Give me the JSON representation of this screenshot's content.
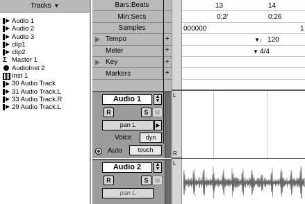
{
  "track_list": {
    "header": "Tracks",
    "items": [
      {
        "name": "Audio 1",
        "icon": "audio-track-icon"
      },
      {
        "name": "Audio 2",
        "icon": "audio-track-icon"
      },
      {
        "name": "Audio 3",
        "icon": "audio-track-icon"
      },
      {
        "name": "clip1",
        "icon": "audio-track-icon"
      },
      {
        "name": "clip2",
        "icon": "audio-track-icon"
      },
      {
        "name": "Master 1",
        "icon": "master-fader-icon"
      },
      {
        "name": "AudioInst  2",
        "icon": "aux-input-icon"
      },
      {
        "name": "Inst 1",
        "icon": "instrument-track-icon"
      },
      {
        "name": "30 Audio Track",
        "icon": "audio-track-icon"
      },
      {
        "name": "31 Audio Track.L",
        "icon": "audio-track-icon"
      },
      {
        "name": "33 Audio Track.R",
        "icon": "audio-track-icon"
      },
      {
        "name": "29 Audio Track.L",
        "icon": "audio-track-icon"
      }
    ]
  },
  "rulers": {
    "bars_beats": {
      "label": "Bars:Beats",
      "marks": [
        "13",
        "14"
      ]
    },
    "min_secs": {
      "label": "Min:Secs",
      "marks": [
        "0:2⁄",
        "0:26"
      ]
    },
    "samples": {
      "label": "Samples",
      "marks": [
        "000000",
        "1"
      ]
    },
    "tempo": {
      "label": "Tempo",
      "value": "120"
    },
    "meter": {
      "label": "Meter",
      "value": "4/4"
    },
    "key": {
      "label": "Key"
    },
    "markers": {
      "label": "Markers"
    }
  },
  "tracks": [
    {
      "name": "Audio 1",
      "rec": "R",
      "solo": "S",
      "mute": "M",
      "pan": "pan L",
      "voice_label": "Voice",
      "voice": "dyn",
      "auto_label": "Auto",
      "auto": "touch",
      "channels": [
        "L",
        "R"
      ]
    },
    {
      "name": "Audio 2",
      "rec": "R",
      "solo": "S",
      "mute": "M",
      "pan": "pan L",
      "channels": [
        "L"
      ]
    }
  ]
}
